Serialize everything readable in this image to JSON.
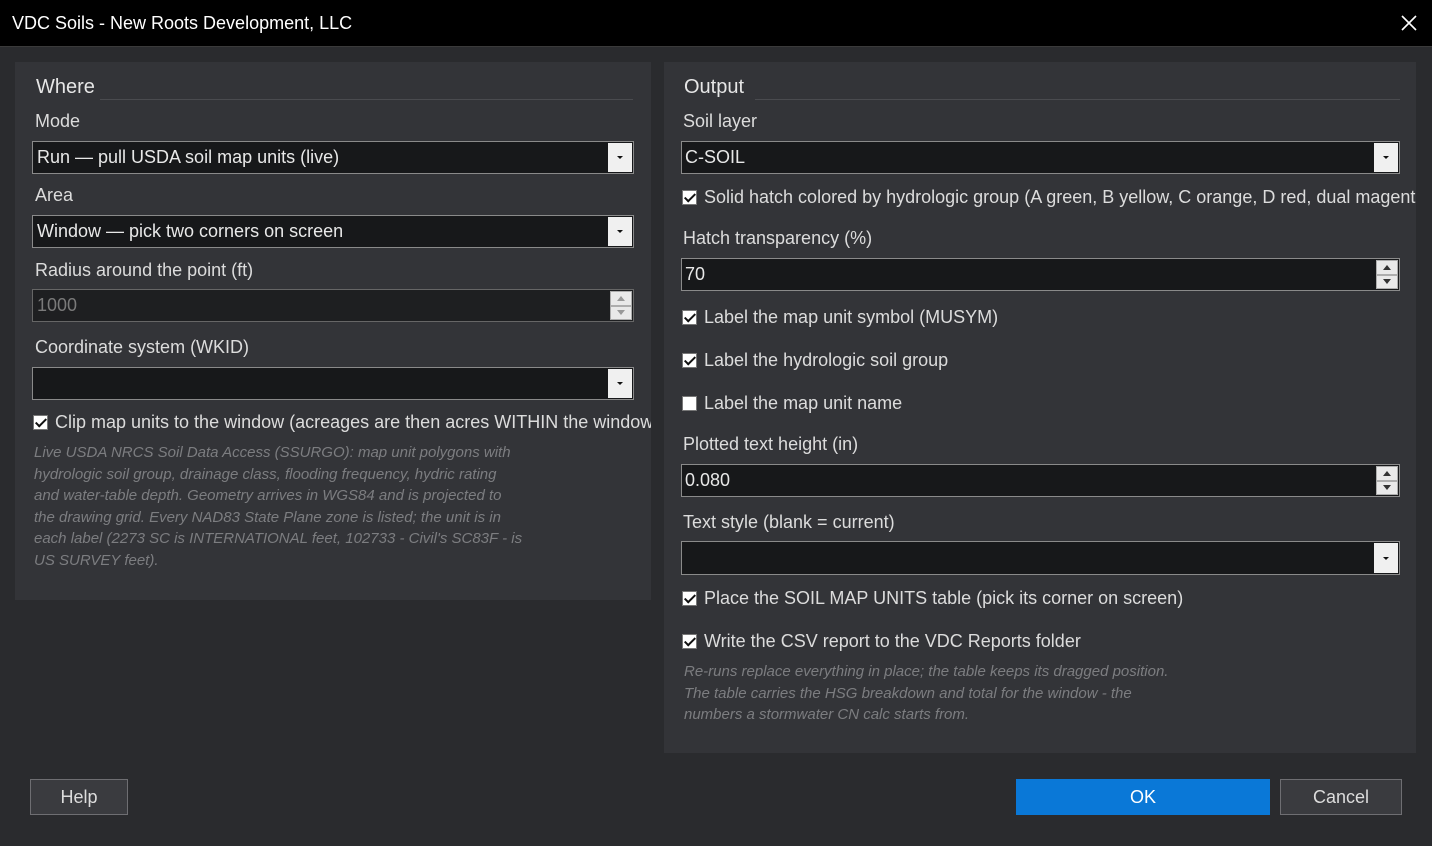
{
  "window": {
    "title": "VDC Soils - New Roots Development, LLC"
  },
  "where": {
    "group_title": "Where",
    "mode_label": "Mode",
    "mode_value": "Run — pull USDA soil map units (live)",
    "area_label": "Area",
    "area_value": "Window — pick two corners on screen",
    "radius_label": "Radius around the point (ft)",
    "radius_value": "1000",
    "coord_label": "Coordinate system (WKID)",
    "coord_value": "",
    "clip_label": "Clip map units to the window (acreages are then acres WITHIN the window)",
    "clip_checked": true,
    "note_lines": [
      "Live USDA NRCS Soil Data Access (SSURGO): map unit polygons with",
      "hydrologic soil group, drainage class, flooding frequency, hydric rating",
      "and water-table depth. Geometry arrives in WGS84 and is projected to",
      "the drawing grid. Every NAD83 State Plane zone is listed; the unit is in",
      "each label (2273 SC is INTERNATIONAL feet, 102733 - Civil's SC83F - is",
      "US SURVEY feet)."
    ]
  },
  "output": {
    "group_title": "Output",
    "soil_layer_label": "Soil layer",
    "soil_layer_value": "C-SOIL",
    "solid_hatch_label": "Solid hatch colored by hydrologic group (A green, B yellow, C orange, D red, dual magenta)",
    "solid_hatch_checked": true,
    "transparency_label": "Hatch transparency (%)",
    "transparency_value": "70",
    "label_musym": "Label the map unit symbol (MUSYM)",
    "label_musym_checked": true,
    "label_hsg": "Label the hydrologic soil group",
    "label_hsg_checked": true,
    "label_name": "Label the map unit name",
    "label_name_checked": false,
    "text_height_label": "Plotted text height (in)",
    "text_height_value": "0.080",
    "text_style_label": "Text style (blank = current)",
    "text_style_value": "",
    "place_table_label": "Place the SOIL MAP UNITS table (pick its corner on screen)",
    "place_table_checked": true,
    "csv_label": "Write the CSV report to the VDC Reports folder",
    "csv_checked": true,
    "note_lines": [
      "Re-runs replace everything in place; the table keeps its dragged position.",
      "The table carries the HSG breakdown and total for the window - the",
      "numbers a stormwater CN calc starts from."
    ]
  },
  "buttons": {
    "help": "Help",
    "ok": "OK",
    "cancel": "Cancel"
  },
  "colors": {
    "accent": "#0a78d7",
    "titlebar": "#000000",
    "panel": "#333438",
    "background": "#2a2b2e"
  }
}
